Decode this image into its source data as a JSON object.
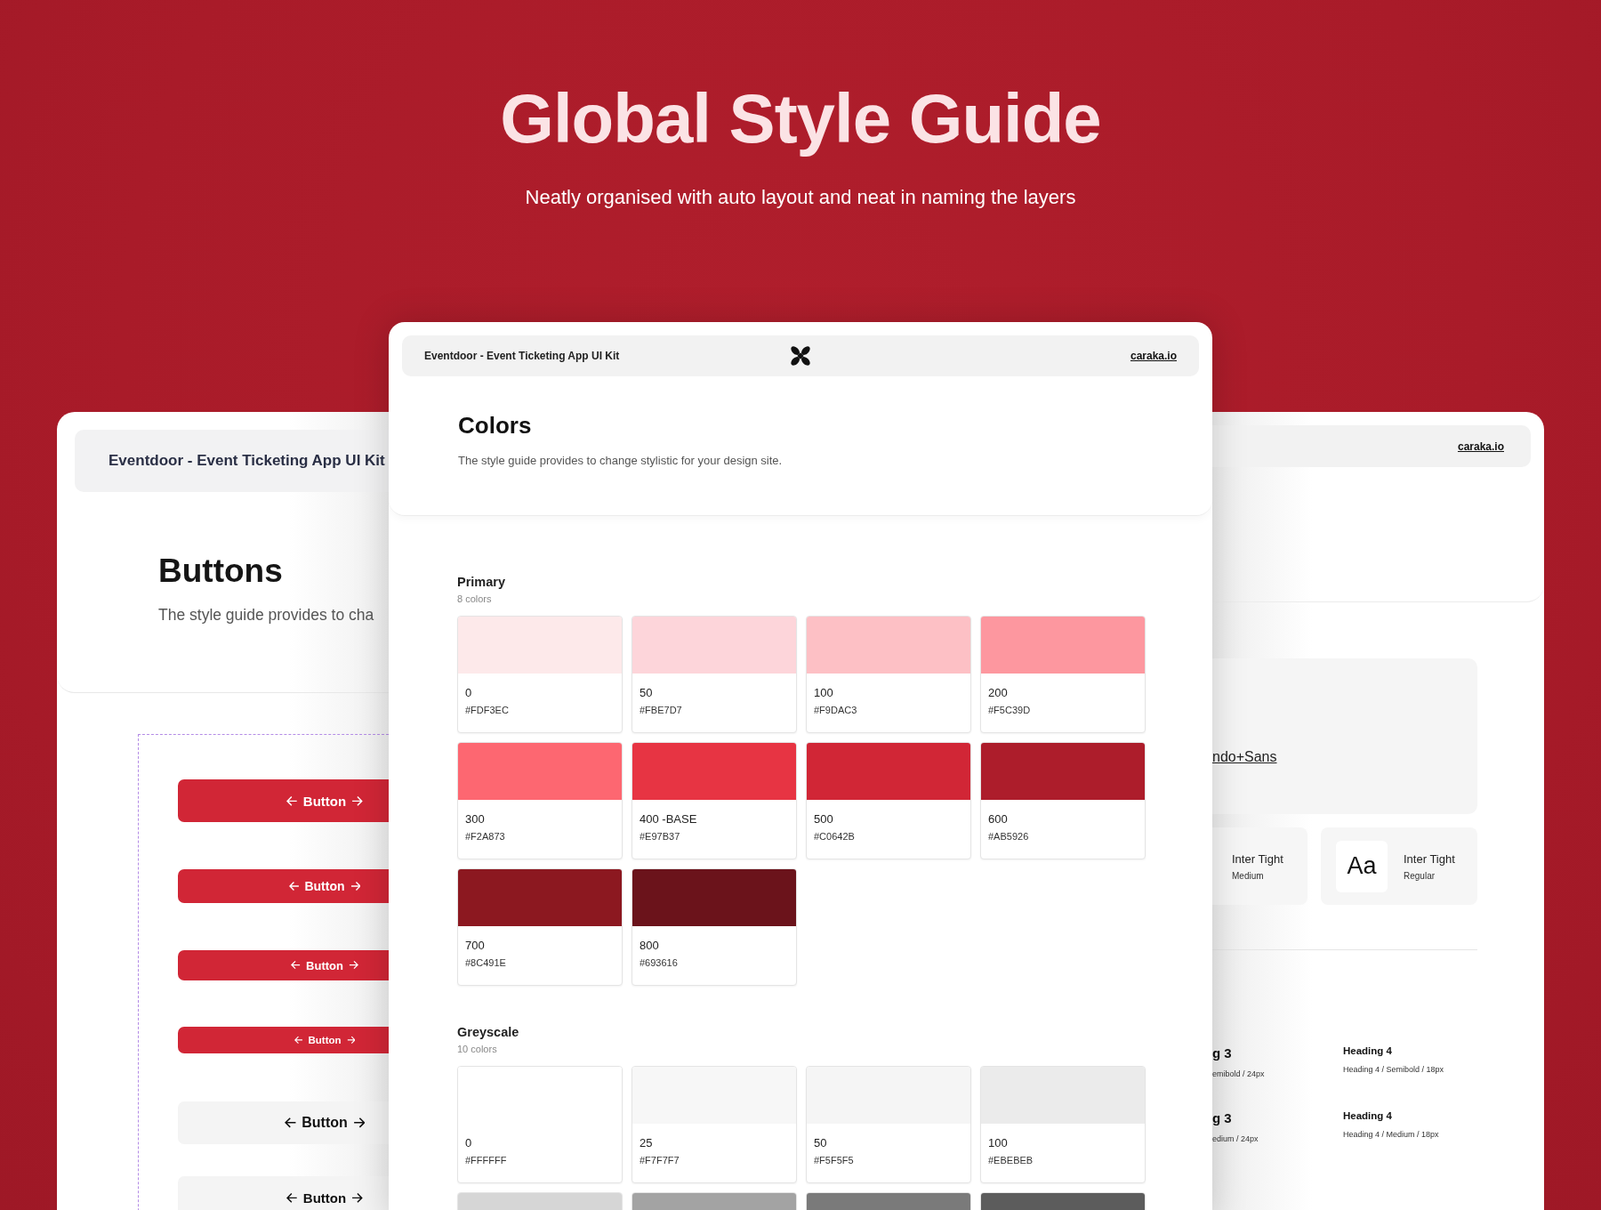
{
  "hero": {
    "title": "Global Style Guide",
    "subtitle": "Neatly organised with auto layout and neat in naming the layers"
  },
  "left_card": {
    "header_title": "Eventdoor - Event Ticketing App UI Kit",
    "heading": "Buttons",
    "description": "The style guide provides to cha",
    "buttons": [
      {
        "label": "Button",
        "kind": "filled"
      },
      {
        "label": "Button",
        "kind": "filled"
      },
      {
        "label": "Button",
        "kind": "filled"
      },
      {
        "label": "Button",
        "kind": "filled"
      },
      {
        "label": "Button",
        "kind": "grey"
      },
      {
        "label": "Button",
        "kind": "grey"
      }
    ]
  },
  "center_card": {
    "header_title": "Eventdoor - Event Ticketing App UI Kit",
    "link": "caraka.io",
    "heading": "Colors",
    "description": "The style guide provides to change stylistic for your design site.",
    "palettes": [
      {
        "name": "Primary",
        "count": "8 colors",
        "swatches": [
          {
            "level": "0",
            "hex": "#FDF3EC",
            "color": "#fde9ea"
          },
          {
            "level": "50",
            "hex": "#FBE7D7",
            "color": "#fdd5da"
          },
          {
            "level": "100",
            "hex": "#F9DAC3",
            "color": "#fdc0c5"
          },
          {
            "level": "200",
            "hex": "#F5C39D",
            "color": "#fd979f"
          },
          {
            "level": "300",
            "hex": "#F2A873",
            "color": "#fd6771"
          },
          {
            "level": "400 -BASE",
            "hex": "#E97B37",
            "color": "#e73443"
          },
          {
            "level": "500",
            "hex": "#C0642B",
            "color": "#d12636"
          },
          {
            "level": "600",
            "hex": "#AB5926",
            "color": "#ad1d2b"
          },
          {
            "level": "700",
            "hex": "#8C491E",
            "color": "#8c1820"
          },
          {
            "level": "800",
            "hex": "#693616",
            "color": "#6b131b"
          }
        ]
      },
      {
        "name": "Greyscale",
        "count": "10 colors",
        "swatches": [
          {
            "level": "0",
            "hex": "#FFFFFF",
            "color": "#ffffff"
          },
          {
            "level": "25",
            "hex": "#F7F7F7",
            "color": "#f7f7f7"
          },
          {
            "level": "50",
            "hex": "#F5F5F5",
            "color": "#f5f5f5"
          },
          {
            "level": "100",
            "hex": "#EBEBEB",
            "color": "#ebebeb"
          },
          {
            "color": "#d6d6d6"
          },
          {
            "color": "#a3a3a3"
          },
          {
            "color": "#7a7a7a"
          },
          {
            "color": "#5c5c5c"
          }
        ]
      }
    ]
  },
  "right_card": {
    "link": "caraka.io",
    "font_link": "ndo+Sans",
    "fonts": [
      {
        "name": "Inter Tight",
        "weight": "Medium"
      },
      {
        "name": "Inter Tight",
        "weight": "Regular",
        "sample": "Aa"
      }
    ],
    "type_specs": [
      {
        "title": "g 3",
        "spec": "emibold / 24px"
      },
      {
        "title": "Heading 4",
        "spec": "Heading 4 / Semibold / 18px"
      },
      {
        "title": "g 3",
        "spec": "edium / 24px"
      },
      {
        "title": "Heading 4",
        "spec": "Heading 4 / Medium / 18px"
      }
    ]
  }
}
